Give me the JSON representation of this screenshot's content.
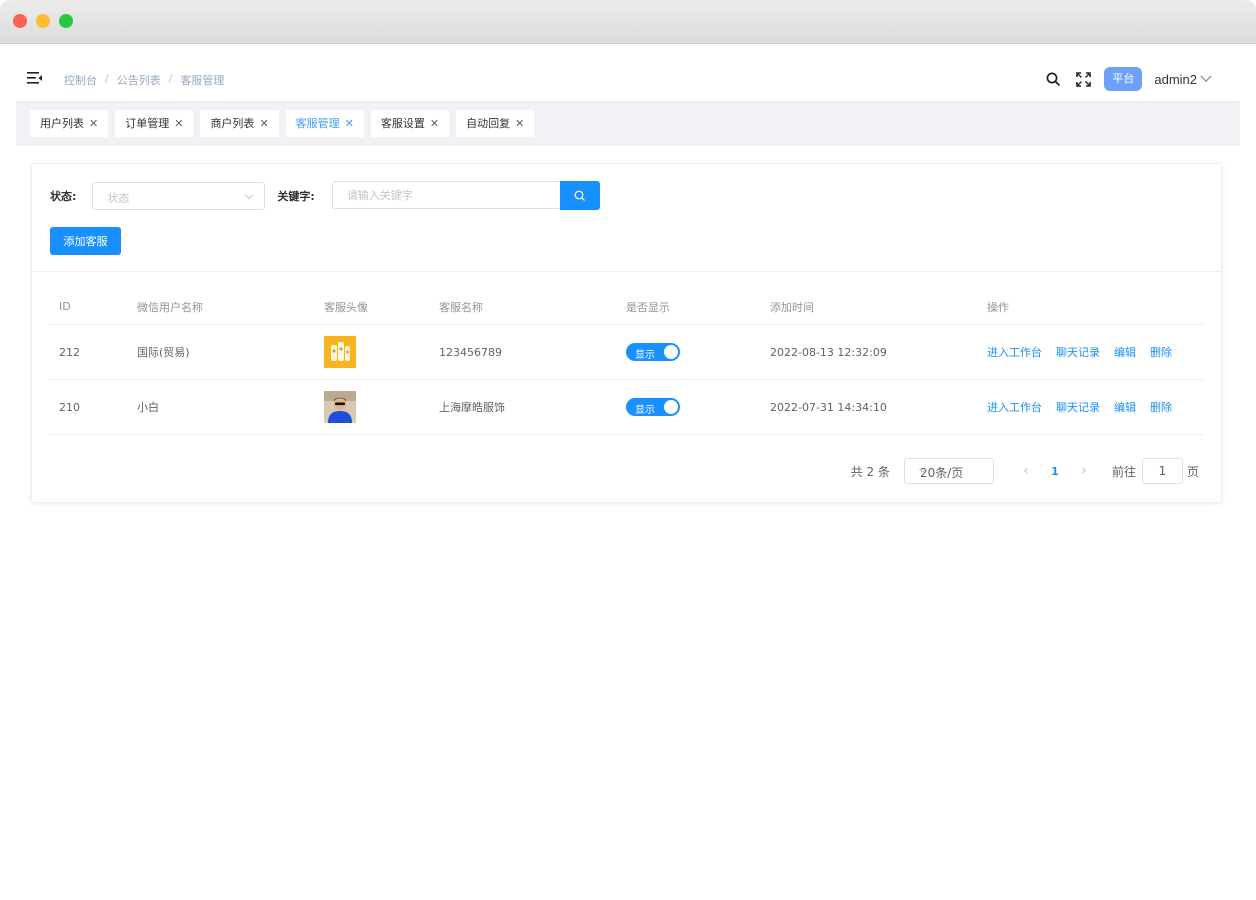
{
  "header": {
    "breadcrumb": [
      "控制台",
      "公告列表",
      "客服管理"
    ],
    "platform_badge": "平台",
    "username": "admin2"
  },
  "tabs": [
    {
      "label": "用户列表",
      "active": false
    },
    {
      "label": "订单管理",
      "active": false
    },
    {
      "label": "商户列表",
      "active": false
    },
    {
      "label": "客服管理",
      "active": true
    },
    {
      "label": "客服设置",
      "active": false
    },
    {
      "label": "自动回复",
      "active": false
    }
  ],
  "filter": {
    "status_label": "状态:",
    "status_placeholder": "状态",
    "keyword_label": "关键字:",
    "keyword_placeholder": "请输入关键字"
  },
  "add_button": "添加客服",
  "table": {
    "columns": [
      "ID",
      "微信用户名称",
      "客服头像",
      "客服名称",
      "是否显示",
      "添加时间",
      "操作"
    ],
    "rows": [
      {
        "id": "212",
        "wechat_name": "国际(贸易)",
        "service_name": "123456789",
        "show": "显示",
        "time": "2022-08-13 12:32:09",
        "actions": [
          "进入工作台",
          "聊天记录",
          "编辑",
          "删除"
        ]
      },
      {
        "id": "210",
        "wechat_name": "小白",
        "service_name": "上海摩皓服饰",
        "show": "显示",
        "time": "2022-07-31 14:34:10",
        "actions": [
          "进入工作台",
          "聊天记录",
          "编辑",
          "删除"
        ]
      }
    ]
  },
  "pagination": {
    "total": "共 2 条",
    "page_size": "20条/页",
    "current_page": "1",
    "goto_label": "前往",
    "goto_value": "1",
    "page_suffix": "页"
  },
  "colors": {
    "primary": "#1890ff",
    "badge": "#6ea0f7"
  }
}
